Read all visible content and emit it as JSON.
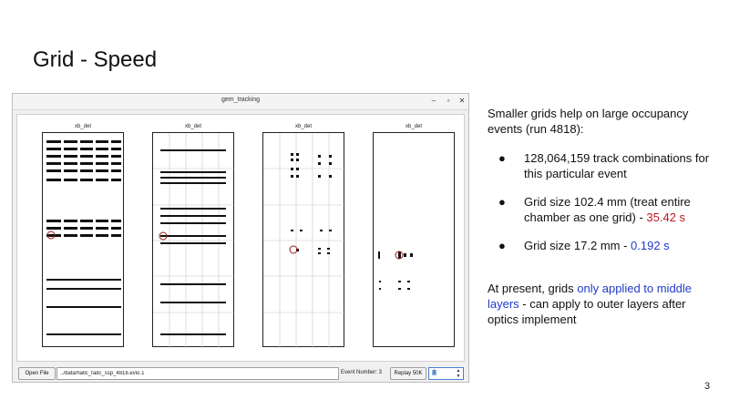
{
  "slide": {
    "title": "Grid - Speed",
    "page_number": "3"
  },
  "window": {
    "title": "gem_tracking",
    "minimize_glyph": "–",
    "maximize_glyph": "▫",
    "close_glyph": "✕"
  },
  "panels": [
    {
      "label": "xb_det",
      "grid_cols": 1,
      "grid_rows": 1
    },
    {
      "label": "xb_det",
      "grid_cols": 5,
      "grid_rows": 6
    },
    {
      "label": "xb_det",
      "grid_cols": 5,
      "grid_rows": 6
    },
    {
      "label": "xb_det",
      "grid_cols": 1,
      "grid_rows": 1
    }
  ],
  "toolbar": {
    "open_label": "Open File",
    "file_path": "../data/hallc_fadc_ssp_4818.evio.1",
    "event_label": "Event Number: 3",
    "replay_label": "Replay 50K",
    "spin_value": "1"
  },
  "notes": {
    "intro": "Smaller grids help on large occupancy events (run 4818):",
    "bullet_glyph": "●",
    "bullet1": "128,064,159 track combinations for this particular event",
    "bullet2_text": "Grid size 102.4 mm (treat entire chamber as one grid) - ",
    "bullet2_time": "35.42 s",
    "bullet3_text": "Grid size 17.2 mm - ",
    "bullet3_time": "0.192 s",
    "present_lead": "At present, grids ",
    "present_highlight": "only applied to middle layers",
    "present_rest": " - can apply to outer layers after optics implement"
  },
  "colors": {
    "red_time": "#c0191f",
    "blue_time": "#1f3ac9",
    "hit_marker": "#9a1b1b"
  }
}
